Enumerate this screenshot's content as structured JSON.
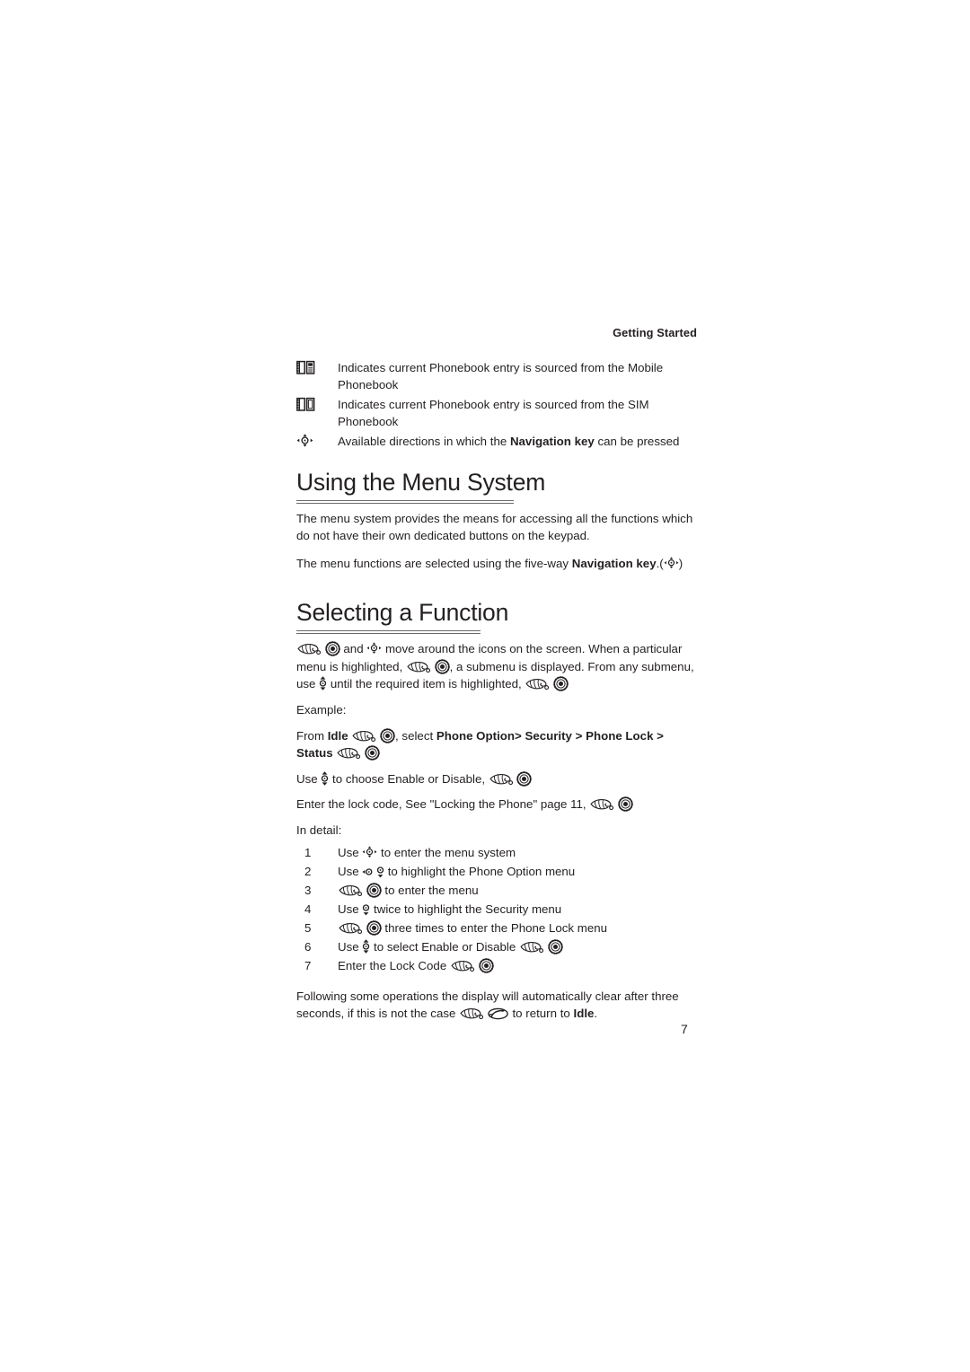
{
  "page": {
    "running_head": "Getting Started",
    "folio": "7"
  },
  "glossary": [
    {
      "icon": "phonebook-mobile-icon",
      "text": "Indicates current Phonebook entry is sourced from the Mobile Phonebook"
    },
    {
      "icon": "phonebook-sim-icon",
      "text": "Indicates current Phonebook entry is sourced from the SIM Phonebook"
    },
    {
      "icon": "navigation-key-icon",
      "text_before": "Available directions in which the ",
      "text_bold": "Navigation key",
      "text_after": " can be pressed"
    }
  ],
  "sections": [
    {
      "id": "using-the-menu-system",
      "heading": "Using the Menu System",
      "paragraphs": [
        "The menu system provides the means for accessing all the functions which do not have their own dedicated buttons on the keypad.",
        {
          "before": "The menu functions are selected using the five-way ",
          "bold": "Navigation key",
          "after": ".(",
          "icon": "navigation-key-icon",
          "tail": ")"
        }
      ]
    },
    {
      "id": "selecting-a-function",
      "heading": "Selecting a Function",
      "intro": {
        "seg1_icon_hand": "hand-pointer-icon",
        "seg1_icon_select": "select-key-icon",
        "seg2": " and ",
        "seg2_icon_nav": "navigation-key-icon",
        "seg3": " move around the icons on the screen.  When a particular menu is highlighted, ",
        "seg3_icon_hand": "hand-pointer-icon",
        "seg3_icon_select": "select-key-icon",
        "seg4": ", a submenu is displayed. From any submenu, use ",
        "seg4_icon_ud": "up-down-arrow-icon",
        "seg5": " until the required item is highlighted, ",
        "seg5_icon_hand": "hand-pointer-icon",
        "seg5_icon_select": "select-key-icon"
      },
      "example_label": "Example:",
      "example": {
        "from": "From ",
        "idle_bold": "Idle",
        "hand": "hand-pointer-icon",
        "select": "select-key-icon",
        "select_text": ", select ",
        "path_bold": "Phone Option> Security > Phone Lock > Status",
        "hand2": "hand-pointer-icon",
        "select2": "select-key-icon"
      },
      "example_lines": [
        {
          "before": "Use ",
          "icon_ud": "up-down-arrow-icon",
          "mid": " to choose Enable or Disable, ",
          "icon_hand": "hand-pointer-icon",
          "icon_select": "select-key-icon"
        },
        {
          "before": "Enter the lock code, See \"Locking the Phone\" page 11, ",
          "icon_hand": "hand-pointer-icon",
          "icon_select": "select-key-icon"
        }
      ],
      "in_detail_label": "In detail:",
      "steps": [
        {
          "num": "1",
          "before": "Use ",
          "icons": [
            "navigation-key-icon"
          ],
          "after": " to enter the menu system"
        },
        {
          "num": "2",
          "before": "Use ",
          "icons": [
            "left-arrow-icon",
            "down-arrow-icon"
          ],
          "after": " to highlight the Phone Option menu"
        },
        {
          "num": "3",
          "before": "",
          "icons": [
            "hand-pointer-icon",
            "select-key-icon"
          ],
          "after": " to enter the menu"
        },
        {
          "num": "4",
          "before": "Use ",
          "icons": [
            "down-arrow-icon"
          ],
          "after": " twice to highlight the Security menu"
        },
        {
          "num": "5",
          "before": "",
          "icons": [
            "hand-pointer-icon",
            "select-key-icon"
          ],
          "after": " three times to enter the Phone Lock menu"
        },
        {
          "num": "6",
          "before": "Use ",
          "icons": [
            "up-down-arrow-icon"
          ],
          "after": " to select Enable or Disable ",
          "trailing_icons": [
            "hand-pointer-icon",
            "select-key-icon"
          ]
        },
        {
          "num": "7",
          "before": "Enter the Lock Code ",
          "icons": [],
          "after": "",
          "trailing_icons": [
            "hand-pointer-icon",
            "select-key-icon"
          ]
        }
      ],
      "closing": {
        "before": "Following some operations the display will automatically clear after three seconds, if this is not the case ",
        "icon_hand": "hand-pointer-icon",
        "icon_end": "end-call-key-icon",
        "mid": " to return to ",
        "bold": "Idle",
        "after": "."
      }
    }
  ],
  "colors": {
    "text": "#231f20",
    "rule": "#6d6a6b",
    "background": "#ffffff"
  }
}
